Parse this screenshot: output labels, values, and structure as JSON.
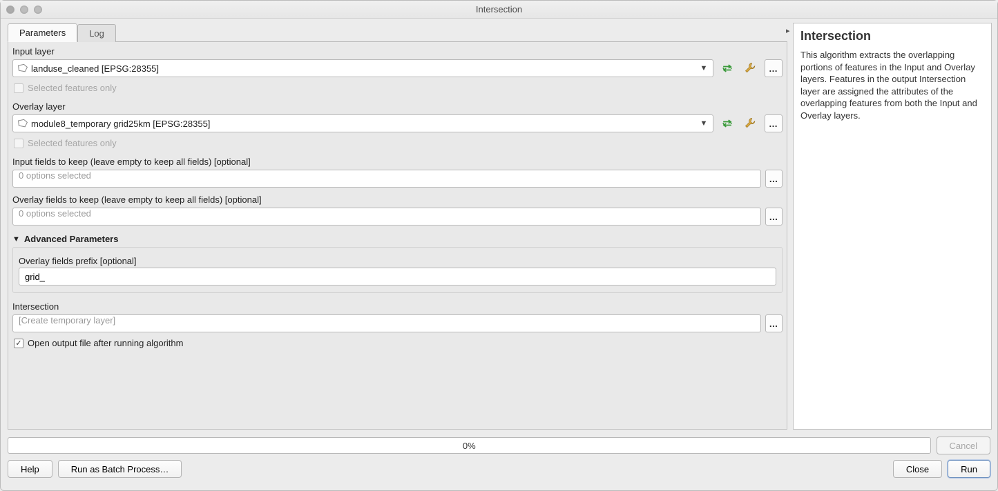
{
  "window": {
    "title": "Intersection"
  },
  "tabs": {
    "parameters": "Parameters",
    "log": "Log"
  },
  "labels": {
    "input_layer": "Input layer",
    "overlay_layer": "Overlay layer",
    "selected_only": "Selected features only",
    "input_fields": "Input fields to keep (leave empty to keep all fields) [optional]",
    "overlay_fields": "Overlay fields to keep (leave empty to keep all fields) [optional]",
    "zero_selected": "0 options selected",
    "advanced": "Advanced Parameters",
    "overlay_prefix": "Overlay fields prefix [optional]",
    "intersection": "Intersection",
    "create_temp": "[Create temporary layer]",
    "open_after": "Open output file after running algorithm"
  },
  "values": {
    "input_layer": "landuse_cleaned [EPSG:28355]",
    "overlay_layer": "module8_temporary grid25km [EPSG:28355]",
    "overlay_prefix": "grid_",
    "progress": "0%"
  },
  "buttons": {
    "cancel": "Cancel",
    "help": "Help",
    "batch": "Run as Batch Process…",
    "close": "Close",
    "run": "Run",
    "dots": "…"
  },
  "help": {
    "title": "Intersection",
    "body": "This algorithm extracts the overlapping portions of features in the Input and Overlay layers. Features in the output Intersection layer are assigned the attributes of the overlapping features from both the Input and Overlay layers."
  }
}
